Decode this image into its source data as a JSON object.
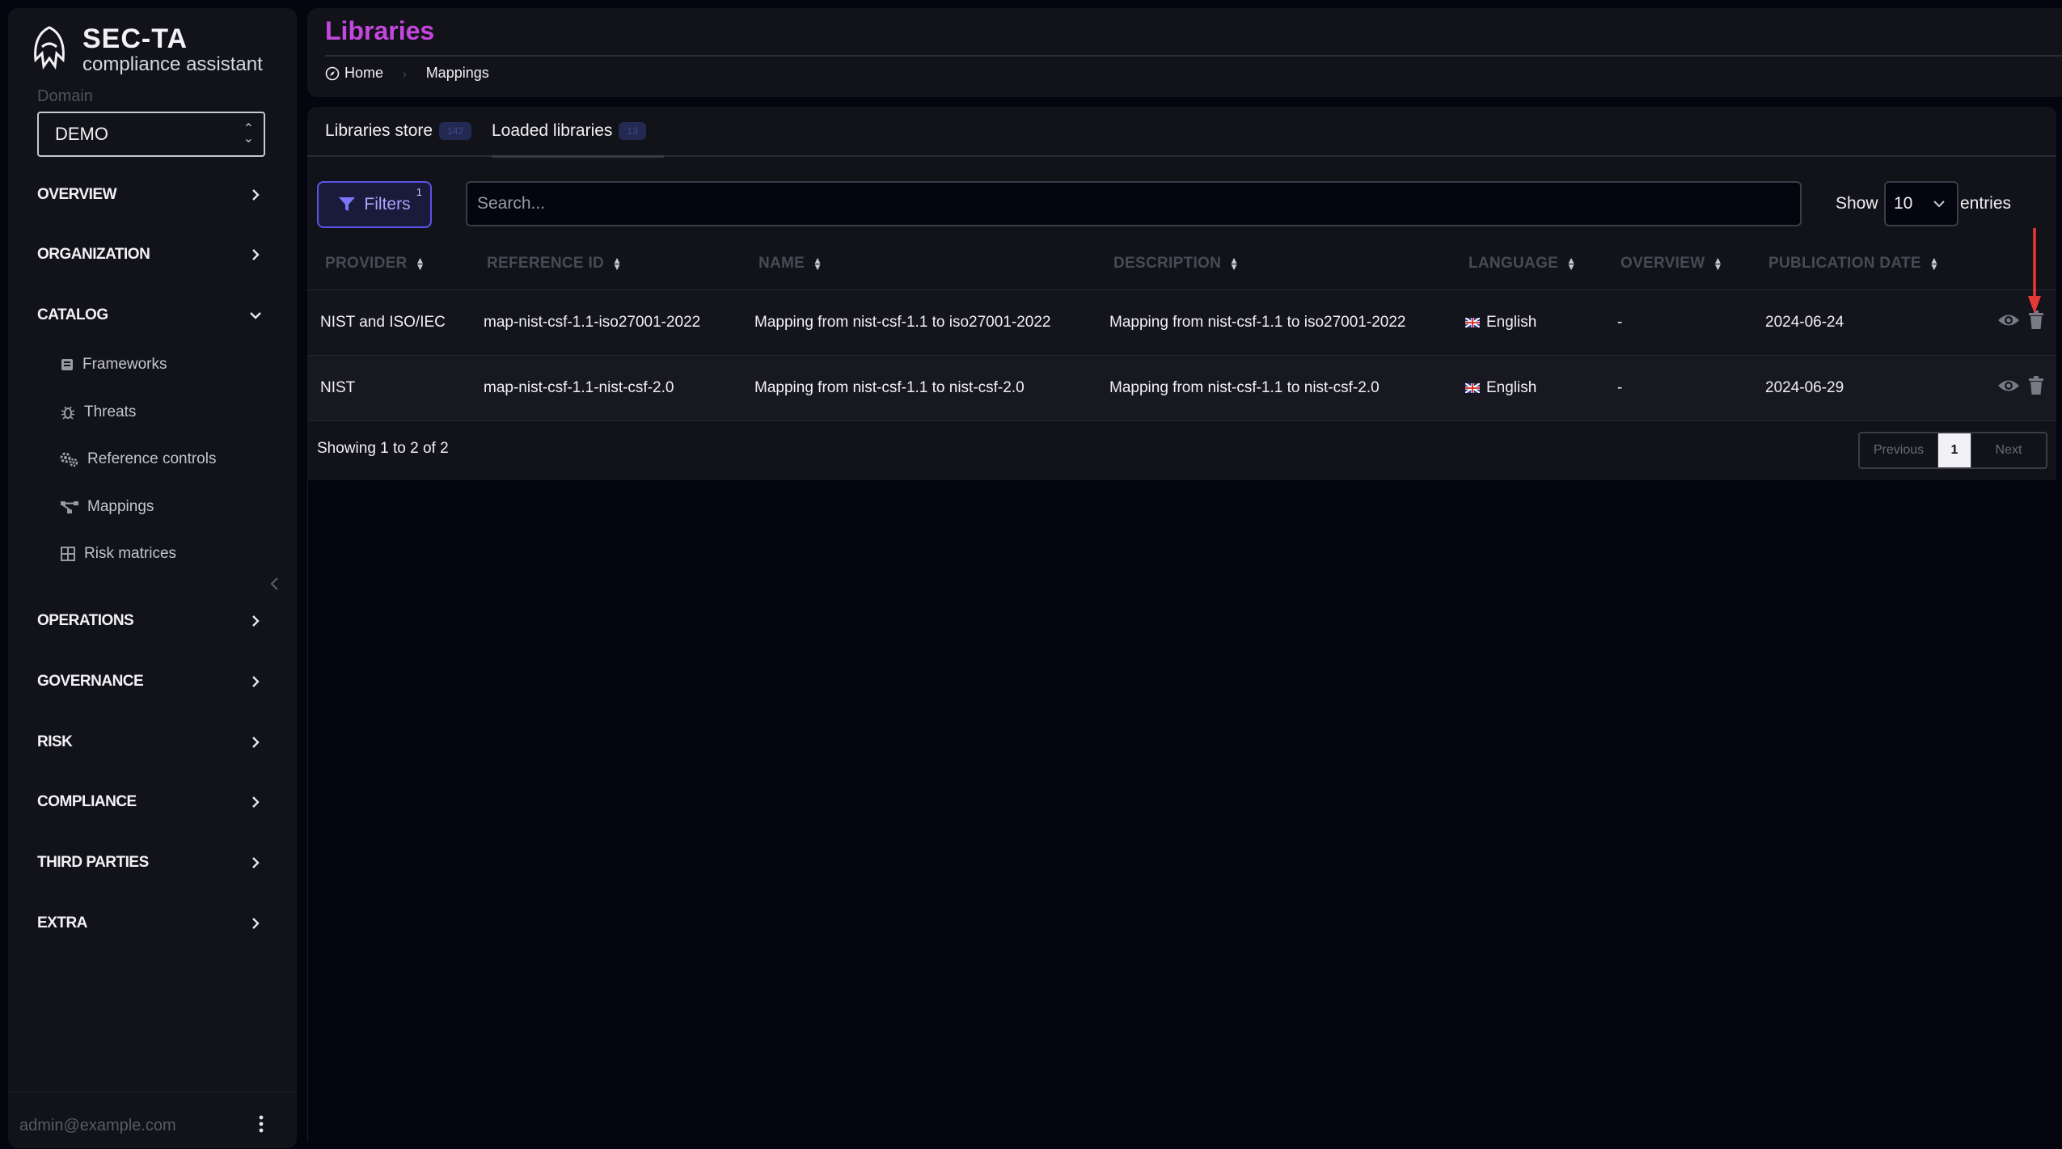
{
  "brand": {
    "name": "SEC-TA",
    "subtitle": "compliance assistant"
  },
  "domain": {
    "label": "Domain",
    "value": "DEMO"
  },
  "sidebar": {
    "sections": [
      {
        "label": "OVERVIEW",
        "icon": "chevron-right-icon"
      },
      {
        "label": "ORGANIZATION",
        "icon": "chevron-right-icon"
      },
      {
        "label": "CATALOG",
        "icon": "chevron-down-icon"
      },
      {
        "label": "OPERATIONS",
        "icon": "chevron-right-icon"
      },
      {
        "label": "GOVERNANCE",
        "icon": "chevron-right-icon"
      },
      {
        "label": "RISK",
        "icon": "chevron-right-icon"
      },
      {
        "label": "COMPLIANCE",
        "icon": "chevron-right-icon"
      },
      {
        "label": "THIRD PARTIES",
        "icon": "chevron-right-icon"
      },
      {
        "label": "EXTRA",
        "icon": "chevron-right-icon"
      }
    ],
    "catalog_items": [
      {
        "label": "Frameworks",
        "icon": "book-icon"
      },
      {
        "label": "Threats",
        "icon": "bug-icon"
      },
      {
        "label": "Reference controls",
        "icon": "gears-icon"
      },
      {
        "label": "Mappings",
        "icon": "diagram-icon"
      },
      {
        "label": "Risk matrices",
        "icon": "table-icon"
      }
    ],
    "user_email": "admin@example.com"
  },
  "header": {
    "title": "Libraries",
    "breadcrumb": [
      {
        "label": "Home",
        "icon": "compass-icon"
      },
      {
        "label": "Mappings"
      }
    ]
  },
  "tabs": [
    {
      "label": "Libraries store",
      "count": "142"
    },
    {
      "label": "Loaded libraries",
      "count": "13"
    }
  ],
  "toolbar": {
    "filters_label": "Filters",
    "filters_count": "1",
    "search_placeholder": "Search...",
    "show_label": "Show",
    "entries_value": "10",
    "entries_label": "entries"
  },
  "table": {
    "columns": [
      "PROVIDER",
      "REFERENCE ID",
      "NAME",
      "DESCRIPTION",
      "LANGUAGE",
      "OVERVIEW",
      "PUBLICATION DATE"
    ],
    "rows": [
      {
        "provider": "NIST and ISO/IEC",
        "ref_id": "map-nist-csf-1.1-iso27001-2022",
        "name": "Mapping from nist-csf-1.1 to iso27001-2022",
        "description": "Mapping from nist-csf-1.1 to iso27001-2022",
        "language": "English",
        "overview": "-",
        "date": "2024-06-24"
      },
      {
        "provider": "NIST",
        "ref_id": "map-nist-csf-1.1-nist-csf-2.0",
        "name": "Mapping from nist-csf-1.1 to nist-csf-2.0",
        "description": "Mapping from nist-csf-1.1 to nist-csf-2.0",
        "language": "English",
        "overview": "-",
        "date": "2024-06-29"
      }
    ]
  },
  "pagination": {
    "summary": "Showing 1 to 2 of 2",
    "previous": "Previous",
    "current": "1",
    "next": "Next"
  },
  "colors": {
    "title": "#c447e0",
    "accent": "#5c53e8",
    "annotation": "#e53935"
  }
}
